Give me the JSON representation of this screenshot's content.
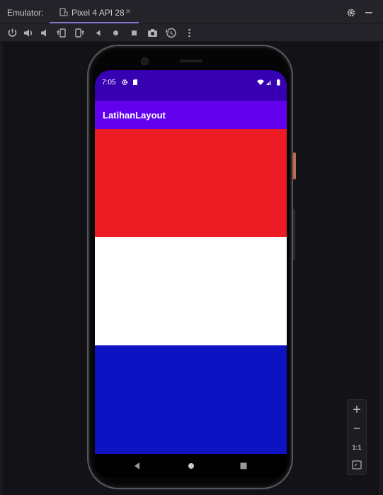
{
  "window": {
    "label": "Emulator:",
    "tab": {
      "title": "Pixel 4 API 28",
      "close": "×"
    }
  },
  "toolbar": {
    "tools": [
      "power-icon",
      "volume-up-icon",
      "volume-down-icon",
      "rotate-left-icon",
      "rotate-right-icon",
      "back-icon",
      "home-icon",
      "overview-icon",
      "screenshot-icon",
      "snapshot-icon",
      "more-icon"
    ]
  },
  "device": {
    "status_bar": {
      "time": "7:05",
      "icons": [
        "settings-icon",
        "sd-card-icon",
        "wifi-icon",
        "signal-icon",
        "battery-icon"
      ]
    },
    "app_bar": {
      "title": "LatihanLayout"
    },
    "stripes": [
      {
        "name": "red",
        "color": "#ed1c24"
      },
      {
        "name": "white",
        "color": "#ffffff"
      },
      {
        "name": "blue",
        "color": "#0d13c3"
      }
    ],
    "nav": [
      "back-icon",
      "home-icon",
      "recents-icon"
    ]
  },
  "zoom": {
    "plus": "+",
    "minus": "−",
    "ratio": "1:1"
  },
  "colors": {
    "status_bar": "#3700b3",
    "app_bar": "#6200ee",
    "tab_accent": "#8a78d0"
  }
}
